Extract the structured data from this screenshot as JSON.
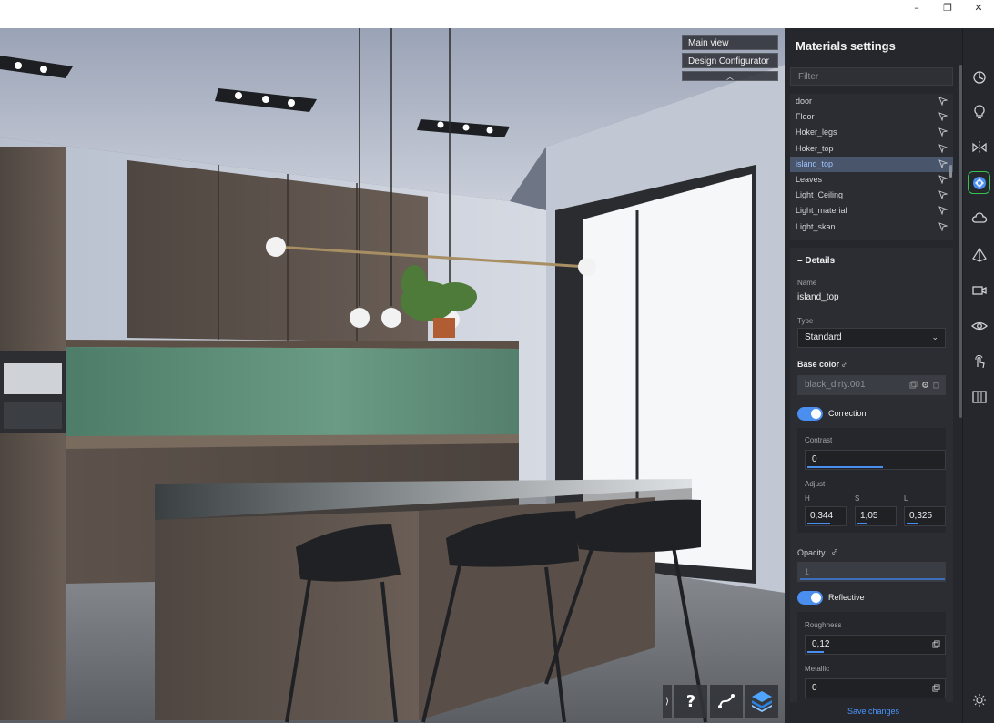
{
  "window": {
    "minimize": "–",
    "restore": "❐",
    "close": "✕"
  },
  "view_menu": {
    "main_view": "Main view",
    "design_configurator": "Design Configurator",
    "collapse": "︿"
  },
  "bottom_tools": {
    "expand": "⟩",
    "help": "?"
  },
  "panel": {
    "title": "Materials settings",
    "filter_placeholder": "Filter",
    "materials": [
      "door",
      "Floor",
      "Hoker_legs",
      "Hoker_top",
      "island_top",
      "Leaves",
      "Light_Ceiling",
      "Light_material",
      "Light_skan"
    ],
    "selected_material": "island_top",
    "details": {
      "section": "Details",
      "name_label": "Name",
      "name_value": "island_top",
      "type_label": "Type",
      "type_value": "Standard",
      "base_color_label": "Base color",
      "base_color_value": "black_dirty.001",
      "correction_label": "Correction",
      "correction_on": true,
      "contrast_label": "Contrast",
      "contrast_value": "0",
      "contrast_fill": 0.55,
      "adjust_label": "Adjust",
      "h_label": "H",
      "s_label": "S",
      "l_label": "L",
      "h_value": "0,344",
      "s_value": "1,05",
      "l_value": "0,325",
      "h_fill": 0.6,
      "s_fill": 0.25,
      "l_fill": 0.3,
      "opacity_label": "Opacity",
      "opacity_value": "1",
      "reflective_label": "Reflective",
      "reflective_on": true,
      "roughness_label": "Roughness",
      "roughness_value": "0,12",
      "roughness_fill": 0.12,
      "metallic_label": "Metallic",
      "metallic_value": "0"
    },
    "save_label": "Save changes"
  },
  "sidebar": {
    "icons": [
      "timer-icon",
      "lightbulb-icon",
      "mirror-icon",
      "materials-icon",
      "cloud-icon",
      "perspective-icon",
      "camera-icon",
      "eye-icon",
      "touch-icon",
      "panels-icon",
      "sun-settings-icon"
    ],
    "active": "materials-icon"
  },
  "colors": {
    "accent": "#4a8ef0",
    "active_tool": "#37c14f",
    "panel_bg": "#25272c",
    "selected_row": "#49556a"
  }
}
